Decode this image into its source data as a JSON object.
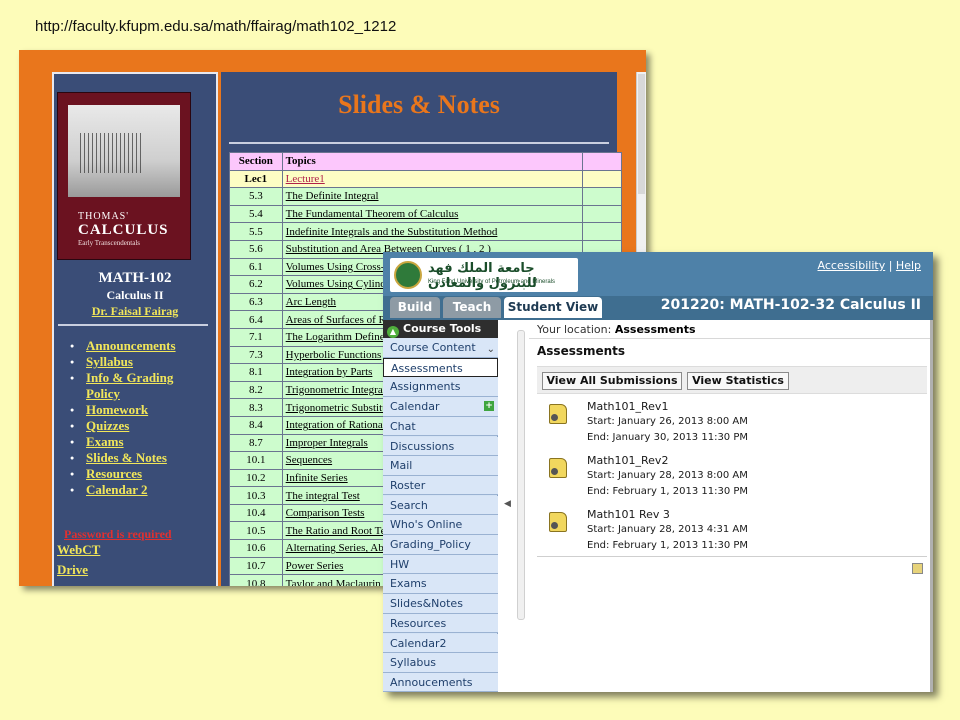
{
  "url_text": "http://faculty.kfupm.edu.sa/math/ffairag/math102_1212",
  "faculty_site": {
    "book": {
      "line1": "THOMAS'",
      "line2": "CALCULUS",
      "line3": "Early Transcendentals"
    },
    "course_code": "MATH-102",
    "course_name": "Calculus II",
    "instructor": "Dr. Faisal Fairag",
    "menu": [
      "Announcements",
      "Syllabus",
      "Info & Grading Policy",
      "Homework",
      "Quizzes",
      "Exams",
      "Slides & Notes",
      "Resources",
      "Calendar 2"
    ],
    "password_note": "Password is required",
    "links": [
      "WebCT",
      "Drive"
    ],
    "page_title": "Slides & Notes",
    "table": {
      "headers": [
        "Section",
        "Topics"
      ],
      "rows": [
        {
          "section": "Lec1",
          "topic": "Lecture1"
        },
        {
          "section": "5.3",
          "topic": "The Definite Integral"
        },
        {
          "section": "5.4",
          "topic": "The Fundamental Theorem of Calculus"
        },
        {
          "section": "5.5",
          "topic": "Indefinite Integrals and the Substitution Method"
        },
        {
          "section": "5.6",
          "topic": "Substitution and Area Between Curves ( 1 , 2 )"
        },
        {
          "section": "6.1",
          "topic": "Volumes Using Cross-"
        },
        {
          "section": "6.2",
          "topic": "Volumes Using Cylind"
        },
        {
          "section": "6.3",
          "topic": "Arc Length"
        },
        {
          "section": "6.4",
          "topic": "Areas of Surfaces of R"
        },
        {
          "section": "7.1",
          "topic": "The Logarithm Defined"
        },
        {
          "section": "7.3",
          "topic": "Hyperbolic Functions"
        },
        {
          "section": "8.1",
          "topic": "Integration by Parts"
        },
        {
          "section": "8.2",
          "topic": "Trigonometric Integrals"
        },
        {
          "section": "8.3",
          "topic": "Trigonometric Substitu"
        },
        {
          "section": "8.4",
          "topic": "Integration of Rational"
        },
        {
          "section": "8.7",
          "topic": "Improper Integrals"
        },
        {
          "section": "10.1",
          "topic": "Sequences"
        },
        {
          "section": "10.2",
          "topic": "Infinite Series"
        },
        {
          "section": "10.3",
          "topic": "The integral Test"
        },
        {
          "section": "10.4",
          "topic": "Comparison Tests"
        },
        {
          "section": "10.5",
          "topic": "The Ratio and Root Te"
        },
        {
          "section": "10.6",
          "topic": "Alternating Series, Abs"
        },
        {
          "section": "10.7",
          "topic": "Power Series"
        },
        {
          "section": "10.8",
          "topic": "Taylor and Maclaurin S"
        }
      ]
    }
  },
  "webct": {
    "logo_arabic": "جامعة الملك فهد للبترول والمعادن",
    "logo_english": "King Fahd University of Petroleum and Minerals",
    "accessibility": "Accessibility",
    "separator": "|",
    "help": "Help",
    "tabs": [
      "Build",
      "Teach",
      "Student View"
    ],
    "course_title": "201220: MATH-102-32 Calculus II",
    "course_tools": "Course Tools",
    "nav": [
      "Course Content",
      "Assessments",
      "Assignments",
      "Calendar",
      "Chat",
      "Discussions",
      "Mail",
      "Roster",
      "Search",
      "Who's Online",
      "Grading_Policy",
      "HW",
      "Exams",
      "Slides&Notes",
      "Resources",
      "Calendar2",
      "Syllabus",
      "Annoucements"
    ],
    "location_label": "Your location:",
    "location_value": "Assessments",
    "heading": "Assessments",
    "buttons": [
      "View All Submissions",
      "View Statistics"
    ],
    "assessments": [
      {
        "name": "Math101_Rev1",
        "start": "Start: January 26, 2013 8:00 AM",
        "end": "End: January 30, 2013 11:30 PM"
      },
      {
        "name": "Math101_Rev2",
        "start": "Start: January 28, 2013 8:00 AM",
        "end": "End: February 1, 2013 11:30 PM"
      },
      {
        "name": "Math101 Rev 3",
        "start": "Start: January 28, 2013 4:31 AM",
        "end": "End: February 1, 2013 11:30 PM"
      }
    ]
  }
}
